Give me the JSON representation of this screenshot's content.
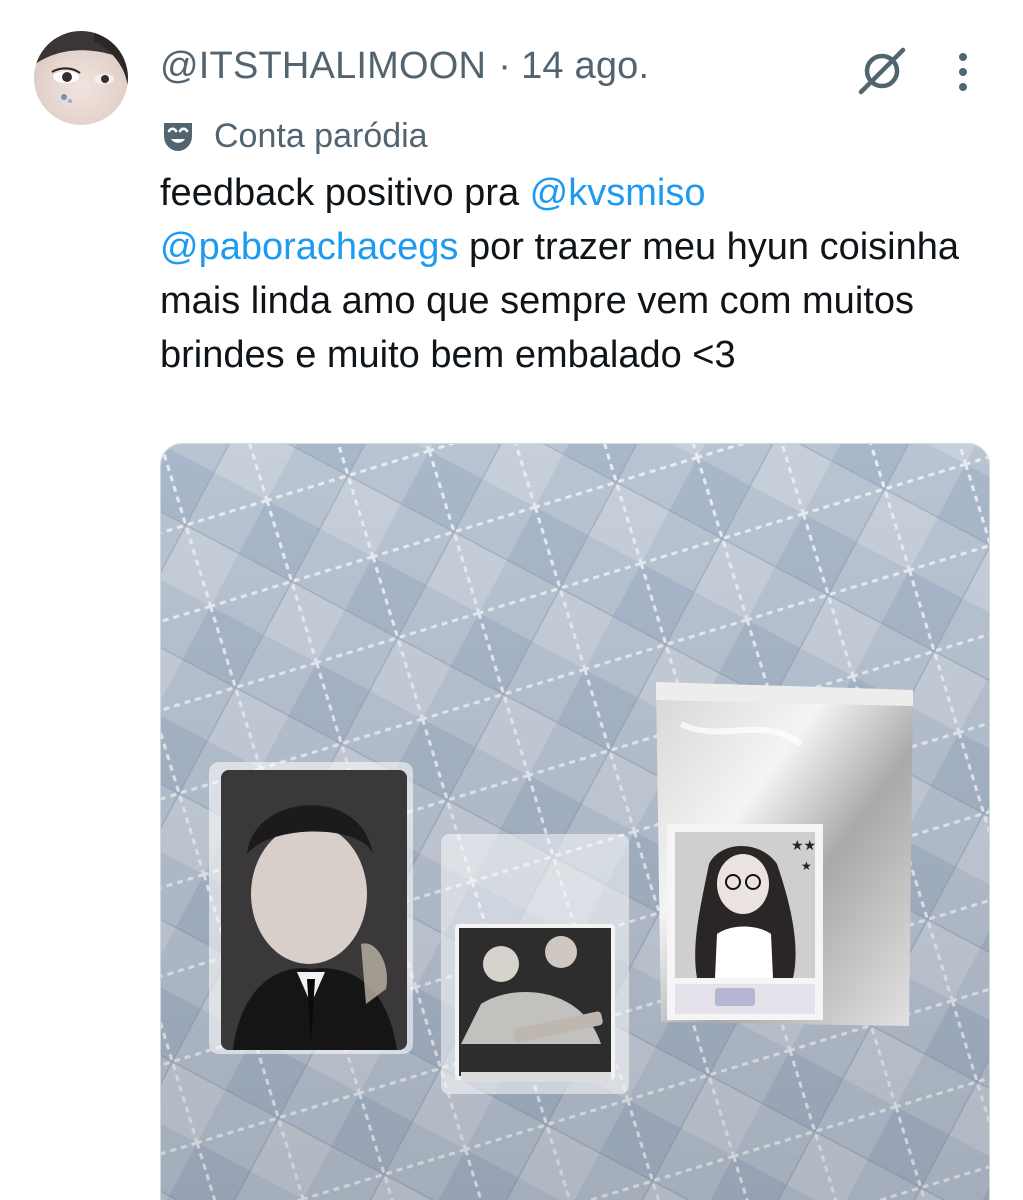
{
  "post": {
    "handle": "@ITSTHALIMOON",
    "separator": "·",
    "date": "14 ago.",
    "label": "Conta paródia",
    "text": {
      "part1": "feedback positivo pra ",
      "mention1": "@kvsmiso",
      "mention2": "@paborachacegs",
      "part2": " por trazer meu hyun coisinha mais linda amo que sempre vem com muitos brindes e muito bem embalado <3"
    }
  },
  "icons": {
    "avatar": "profile-avatar",
    "grok": "grok-icon",
    "more": "more-options-icon",
    "parody": "parody-mask-icon"
  },
  "colors": {
    "mention": "#1d9bf0",
    "secondary_text": "#536471",
    "primary_text": "#0f1419"
  }
}
